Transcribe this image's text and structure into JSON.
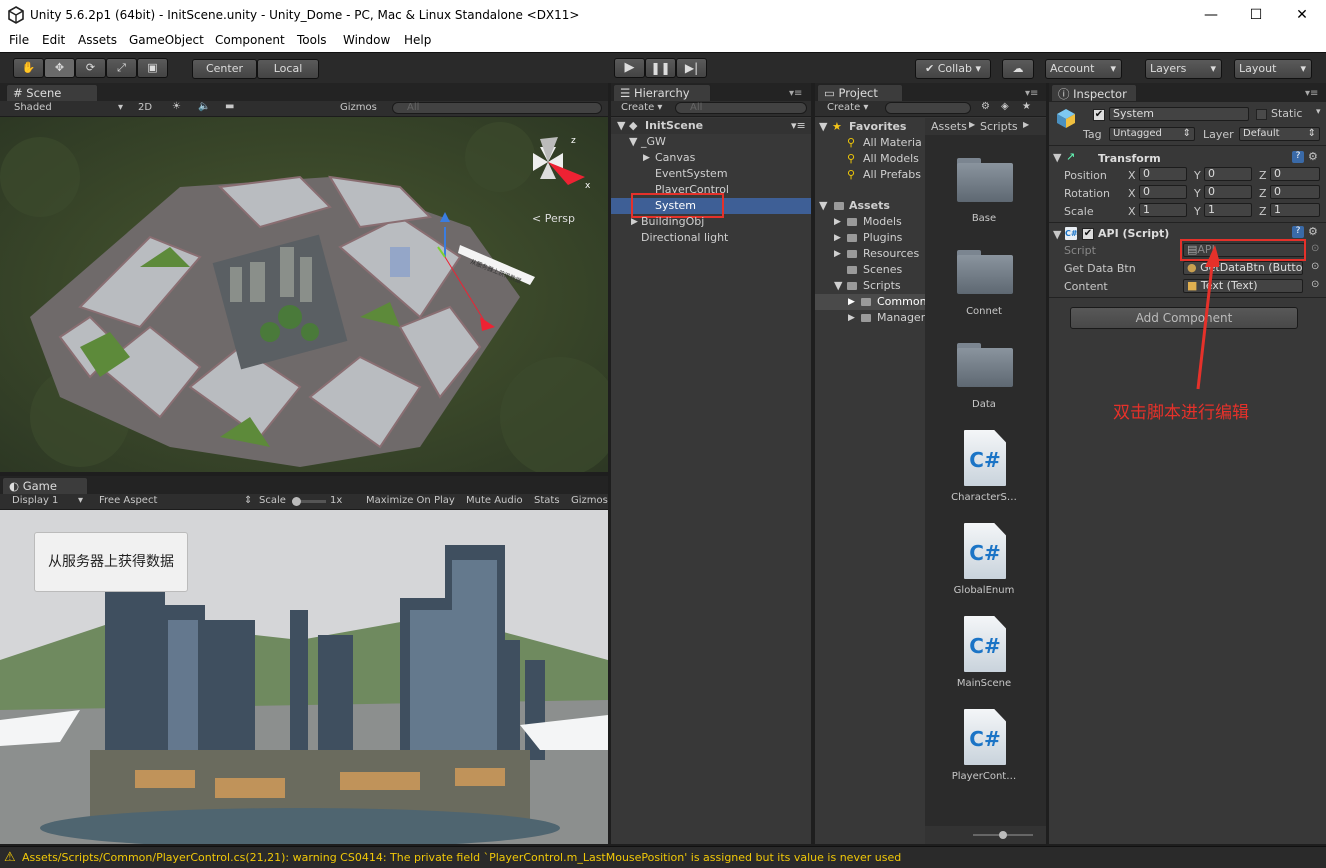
{
  "window": {
    "title": "Unity 5.6.2p1 (64bit) - InitScene.unity - Unity_Dome - PC, Mac & Linux Standalone <DX11>"
  },
  "menu": [
    "File",
    "Edit",
    "Assets",
    "GameObject",
    "Component",
    "Tools",
    "Window",
    "Help"
  ],
  "toolbar": {
    "pivot": "Center",
    "space": "Local",
    "collab": "Collab",
    "account": "Account",
    "layers": "Layers",
    "layout": "Layout"
  },
  "scene": {
    "tab": "Scene",
    "shading": "Shaded",
    "mode2d": "2D",
    "gizmos": "Gizmos",
    "search": "All",
    "persp": "Persp",
    "billboard": "从服务器上获得数据"
  },
  "game": {
    "tab": "Game",
    "display": "Display 1",
    "aspect": "Free Aspect",
    "scale_label": "Scale",
    "scale_value": "1x",
    "maximize": "Maximize On Play",
    "mute": "Mute Audio",
    "stats": "Stats",
    "gizmos": "Gizmos",
    "button": "从服务器上获得数据"
  },
  "hierarchy": {
    "tab": "Hierarchy",
    "create": "Create",
    "search": "All",
    "scene": "InitScene",
    "items": [
      "_GW",
      "Canvas",
      "EventSystem",
      "PlayerControl",
      "System",
      "BuildingObj",
      "Directional light"
    ]
  },
  "project": {
    "tab": "Project",
    "create": "Create",
    "favorites": "Favorites",
    "fav_items": [
      "All Materia",
      "All Models",
      "All Prefabs"
    ],
    "assets": "Assets",
    "asset_folders": [
      "Models",
      "Plugins",
      "Resources",
      "Scenes",
      "Scripts"
    ],
    "script_folders": [
      "Common",
      "Manager"
    ],
    "breadcrumb": [
      "Assets",
      "Scripts"
    ],
    "grid": [
      "Base",
      "Connet",
      "Data",
      "CharacterS…",
      "GlobalEnum",
      "MainScene",
      "PlayerCont…"
    ]
  },
  "inspector": {
    "tab": "Inspector",
    "name": "System",
    "static": "Static",
    "tag_label": "Tag",
    "tag": "Untagged",
    "layer_label": "Layer",
    "layer": "Default",
    "transform": "Transform",
    "rows": [
      {
        "label": "Position",
        "x": "0",
        "y": "0",
        "z": "0"
      },
      {
        "label": "Rotation",
        "x": "0",
        "y": "0",
        "z": "0"
      },
      {
        "label": "Scale",
        "x": "1",
        "y": "1",
        "z": "1"
      }
    ],
    "axis": [
      "X",
      "Y",
      "Z"
    ],
    "component": "API (Script)",
    "script_label": "Script",
    "script_value": "API",
    "btn_label": "Get Data Btn",
    "btn_value": "GetDataBtn (Butto",
    "content_label": "Content",
    "content_value": "Text (Text)",
    "add_component": "Add Component",
    "annotation": "双击脚本进行编辑"
  },
  "status": {
    "message": "Assets/Scripts/Common/PlayerControl.cs(21,21): warning CS0414: The private field `PlayerControl.m_LastMousePosition' is assigned but its value is never used"
  },
  "colors": {
    "selection": "#3e5f96",
    "annotation": "#e5312a",
    "warning": "#f0c808"
  }
}
